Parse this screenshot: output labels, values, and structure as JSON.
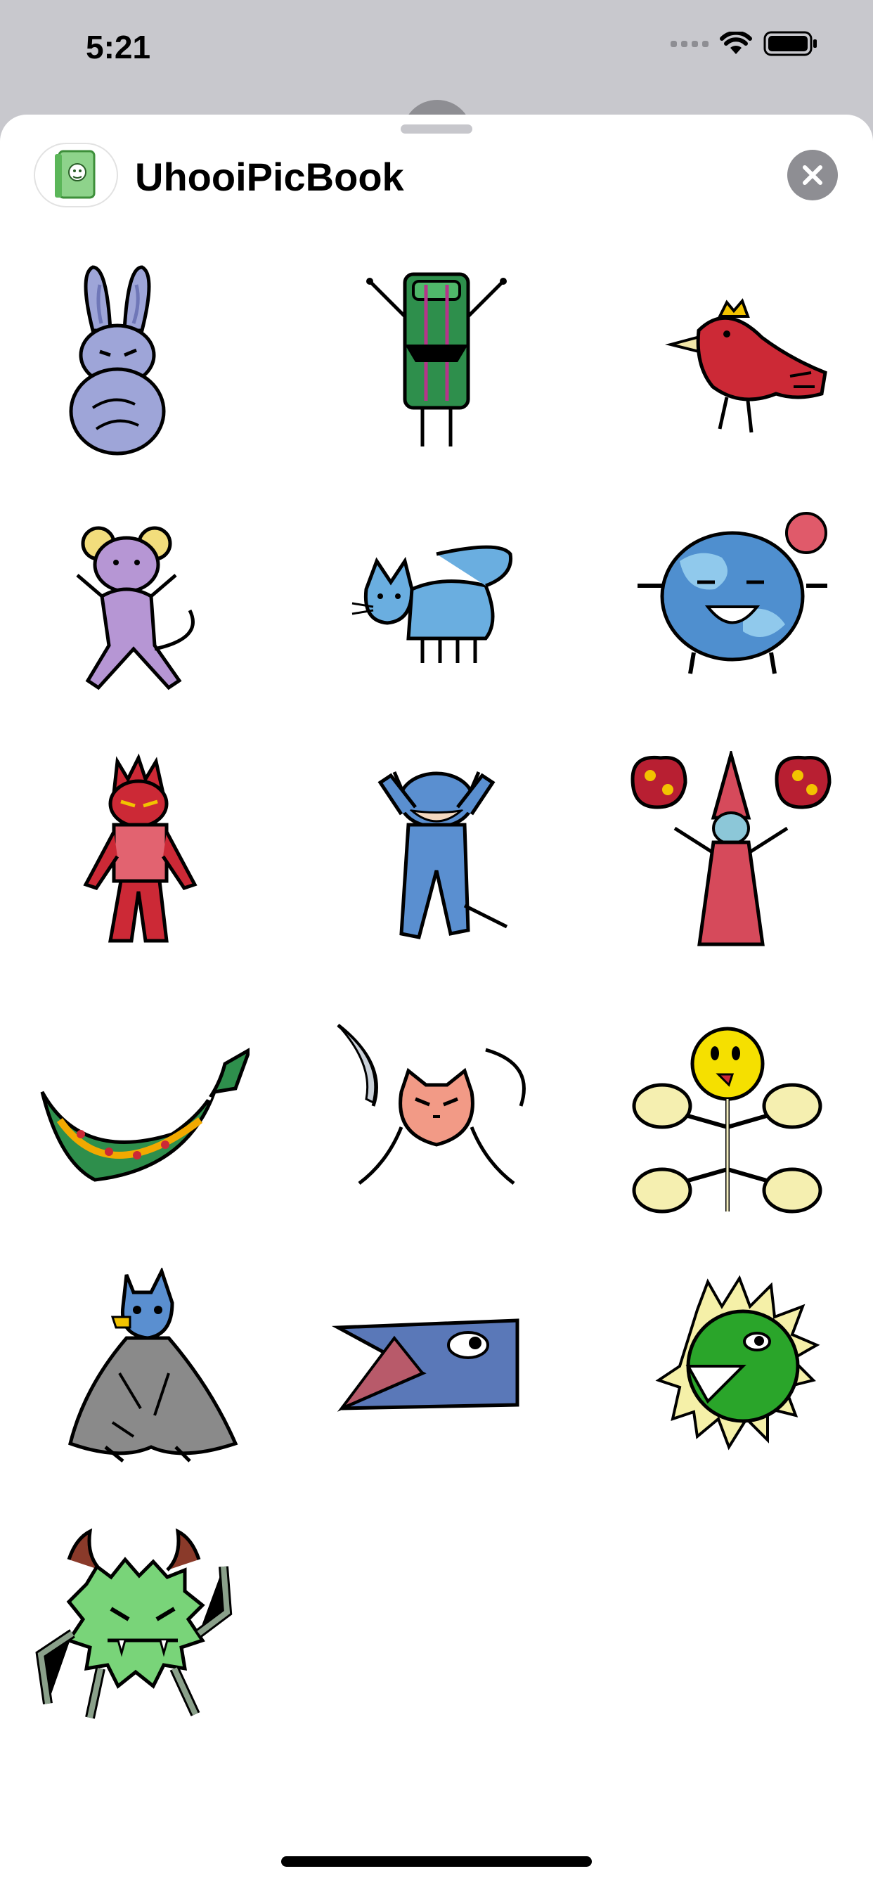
{
  "status_bar": {
    "time": "5:21"
  },
  "app": {
    "title": "UhooiPicBook"
  },
  "stickers": [
    "rabbit",
    "battery-robot",
    "red-bird",
    "purple-mouse",
    "blue-cat",
    "blue-planet",
    "red-demon",
    "blue-creature",
    "wizard",
    "green-dragon",
    "crab-swords",
    "yellow-flower",
    "blue-wolf-cloak",
    "blue-bird-head",
    "green-chomper",
    "green-monster"
  ]
}
